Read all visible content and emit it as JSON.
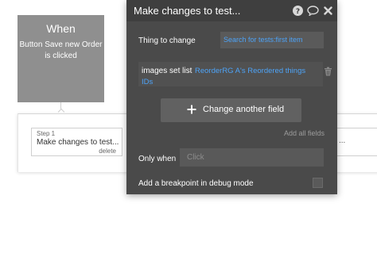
{
  "event": {
    "title": "When",
    "description": "Button Save new Order is clicked"
  },
  "workflow": {
    "step_label": "Step 1",
    "step_action": "Make changes to test...",
    "step_delete": "delete",
    "next_step_overflow": "..."
  },
  "editor": {
    "title": "Make changes to test...",
    "thing_to_change": {
      "label": "Thing to change",
      "value": "Search for tests:first item"
    },
    "field": {
      "label": "images set list",
      "value": "ReorderRG A's Reordered things IDs"
    },
    "change_another_field": "Change another field",
    "add_all_fields": "Add all fields",
    "only_when": {
      "label": "Only when",
      "placeholder": "Click"
    },
    "breakpoint_label": "Add a breakpoint in debug mode"
  },
  "icons": {
    "help": "help-icon",
    "comment": "comment-icon",
    "close": "close-icon",
    "trash": "trash-icon",
    "plus": "plus-icon"
  },
  "colors": {
    "editor_bg": "#4a4a4a",
    "editor_header_bg": "#3f3f3f",
    "link_blue": "#4da3f7",
    "event_card_bg": "#8f8f8f"
  }
}
